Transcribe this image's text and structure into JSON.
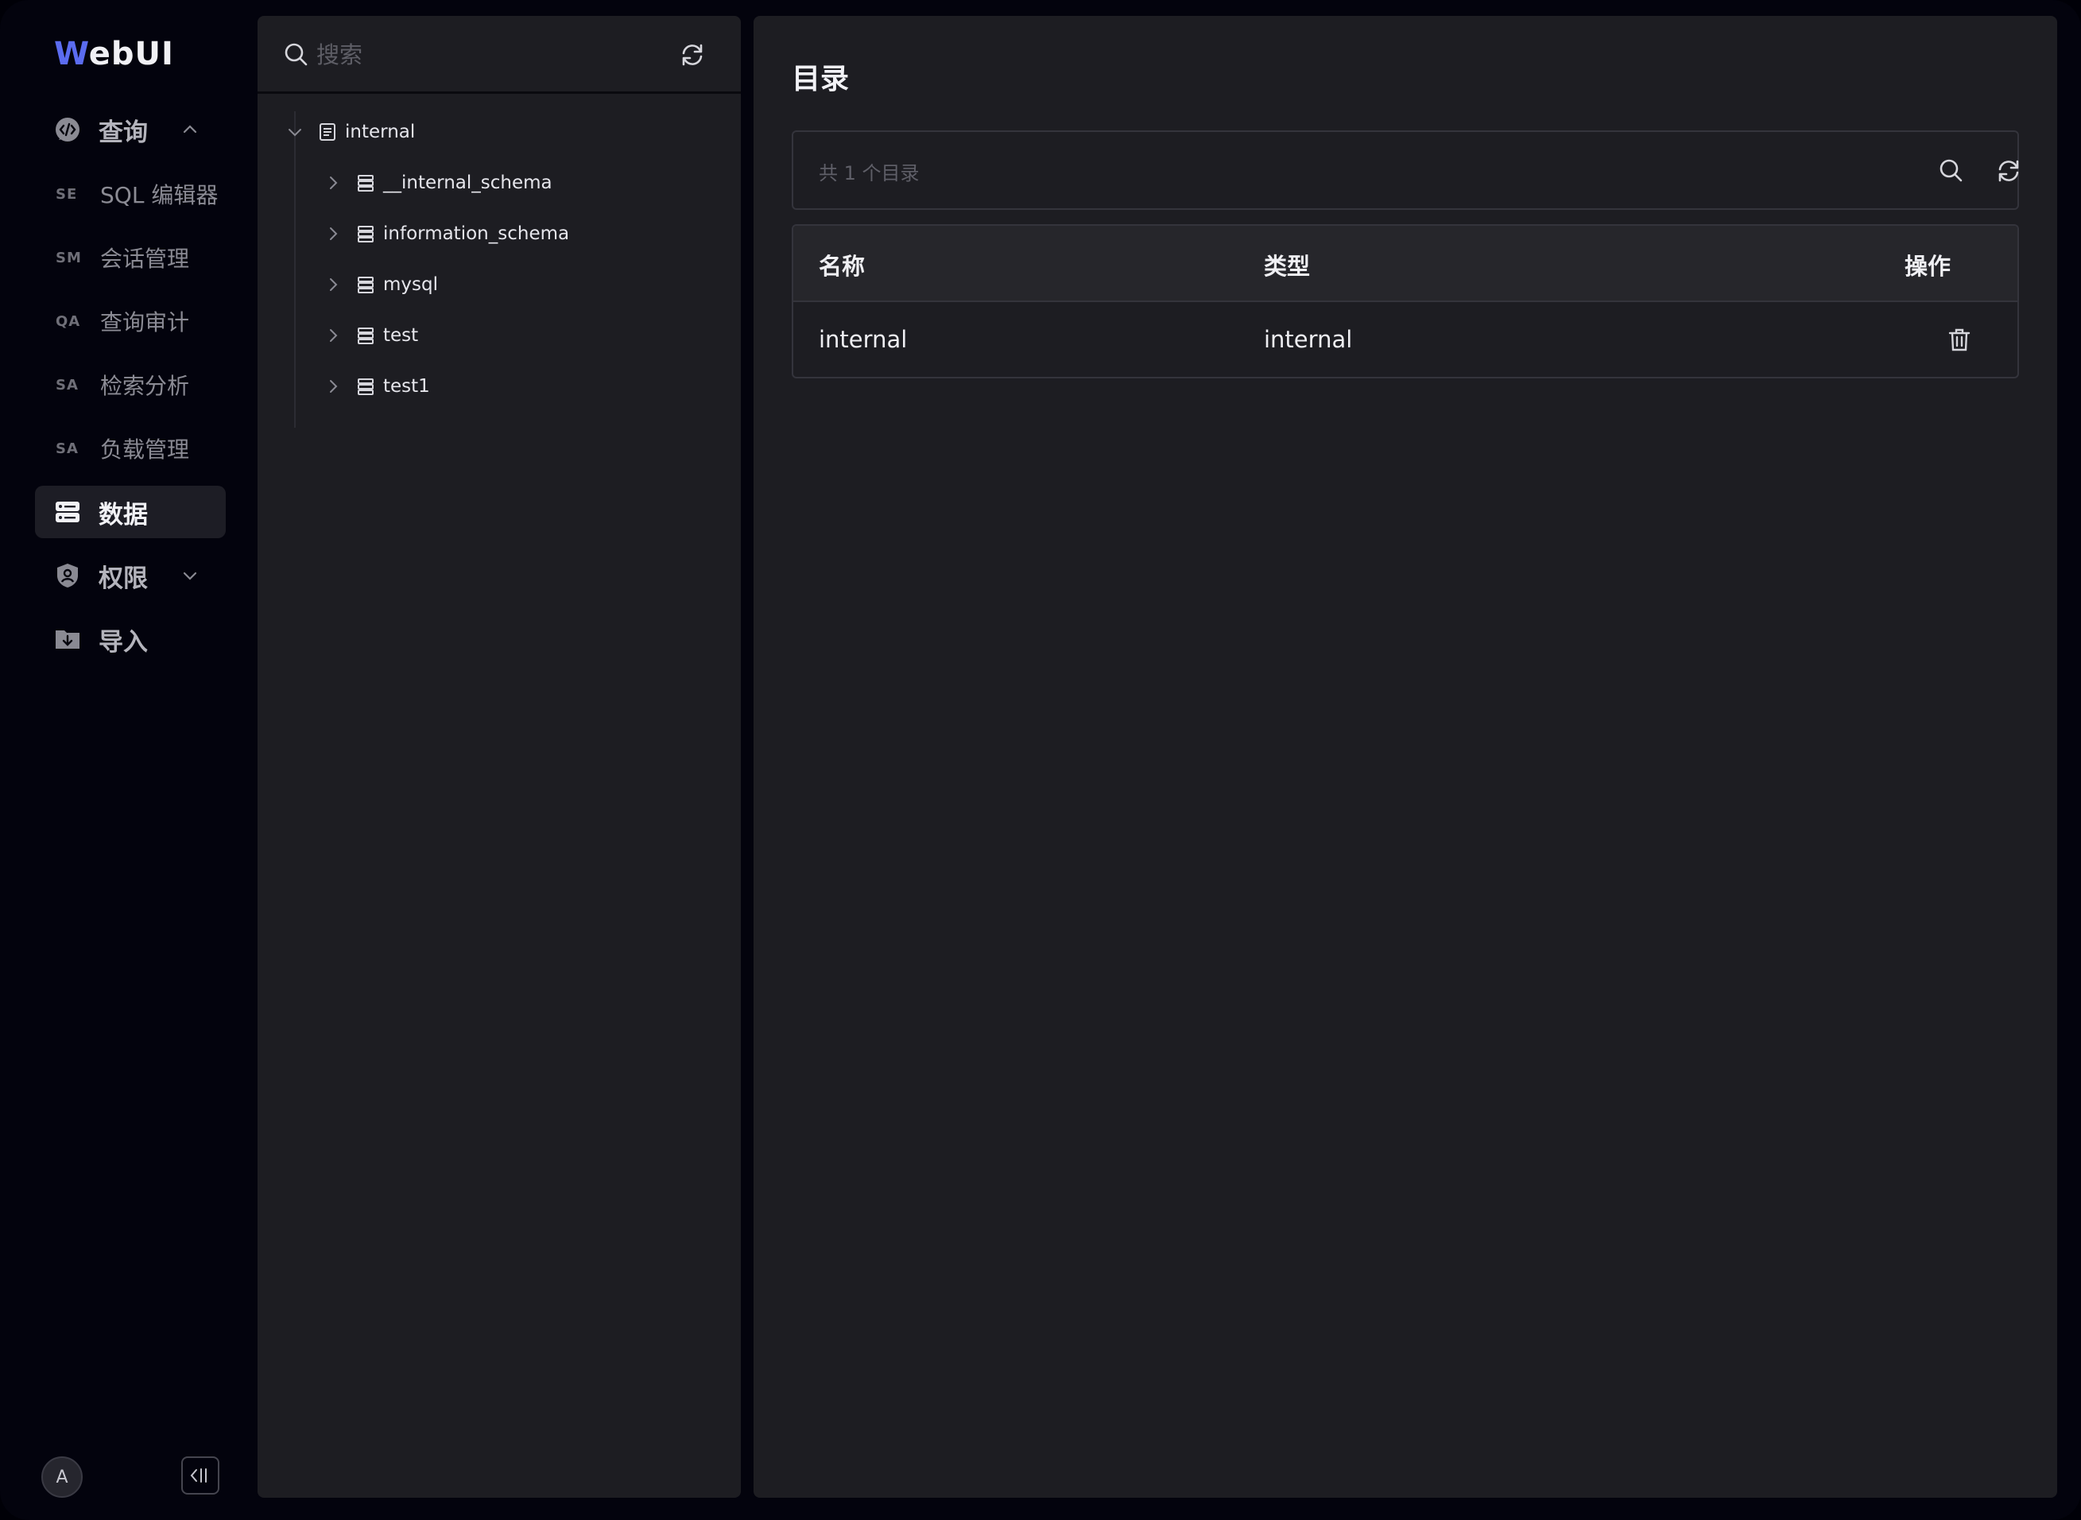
{
  "app": {
    "logo_initial": "W",
    "logo_rest": "ebUI"
  },
  "nav": {
    "query": {
      "label": "查询",
      "icon": "code-bubble-icon",
      "expanded": true
    },
    "sub_items": [
      {
        "abbr": "SE",
        "label": "SQL 编辑器"
      },
      {
        "abbr": "SM",
        "label": "会话管理"
      },
      {
        "abbr": "QA",
        "label": "查询审计"
      },
      {
        "abbr": "SA",
        "label": "检索分析"
      },
      {
        "abbr": "SA",
        "label": "负载管理"
      }
    ],
    "data": {
      "label": "数据",
      "icon": "server-icon",
      "active": true
    },
    "permission": {
      "label": "权限",
      "icon": "shield-user-icon",
      "expanded": false
    },
    "import": {
      "label": "导入",
      "icon": "folder-download-icon"
    },
    "avatar_initial": "A",
    "collapse_icon": "collapse-sidebar-icon"
  },
  "tree": {
    "search_placeholder": "搜索",
    "root": {
      "label": "internal",
      "expanded": true
    },
    "children": [
      {
        "label": "__internal_schema"
      },
      {
        "label": "information_schema"
      },
      {
        "label": "mysql"
      },
      {
        "label": "test"
      },
      {
        "label": "test1"
      }
    ]
  },
  "main": {
    "title": "目录",
    "count_text": "共 1 个目录",
    "table": {
      "headers": {
        "name": "名称",
        "type": "类型",
        "actions": "操作"
      },
      "rows": [
        {
          "name": "internal",
          "type": "internal",
          "action_icon": "trash-icon"
        }
      ]
    }
  },
  "colors": {
    "background": "#03030d",
    "panel": "#1d1d22",
    "accent": "#5b6cf0",
    "text": "#f0f0f4",
    "muted": "#8b8b94"
  }
}
